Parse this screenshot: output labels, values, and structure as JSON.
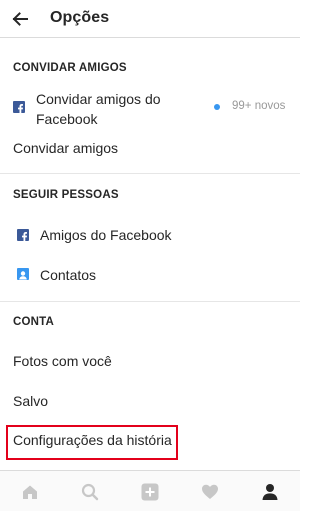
{
  "header": {
    "title": "Opções",
    "back_icon": "arrow-left-icon"
  },
  "sections": {
    "invite": {
      "title": "CONVIDAR AMIGOS",
      "facebook_invite": {
        "label_line1": "Convidar amigos do",
        "label_line2": "Facebook",
        "badge": "99+ novos",
        "icon": "facebook-icon"
      },
      "invite_friends": "Convidar amigos"
    },
    "follow": {
      "title": "SEGUIR PESSOAS",
      "facebook_friends": {
        "label": "Amigos do Facebook",
        "icon": "facebook-icon"
      },
      "contacts": {
        "label": "Contatos",
        "icon": "contact-card-icon"
      }
    },
    "account": {
      "title": "CONTA",
      "photos_of_you": "Fotos com você",
      "saved": "Salvo",
      "story_settings": "Configurações da história"
    }
  },
  "bottom_nav": {
    "items": [
      "home-icon",
      "search-icon",
      "add-post-icon",
      "heart-icon",
      "profile-icon"
    ],
    "active": "profile-icon"
  },
  "colors": {
    "accent_blue": "#3897f0",
    "facebook_blue": "#3b5998",
    "highlight_red": "#e3001b",
    "text": "#262626",
    "muted": "#999999"
  }
}
